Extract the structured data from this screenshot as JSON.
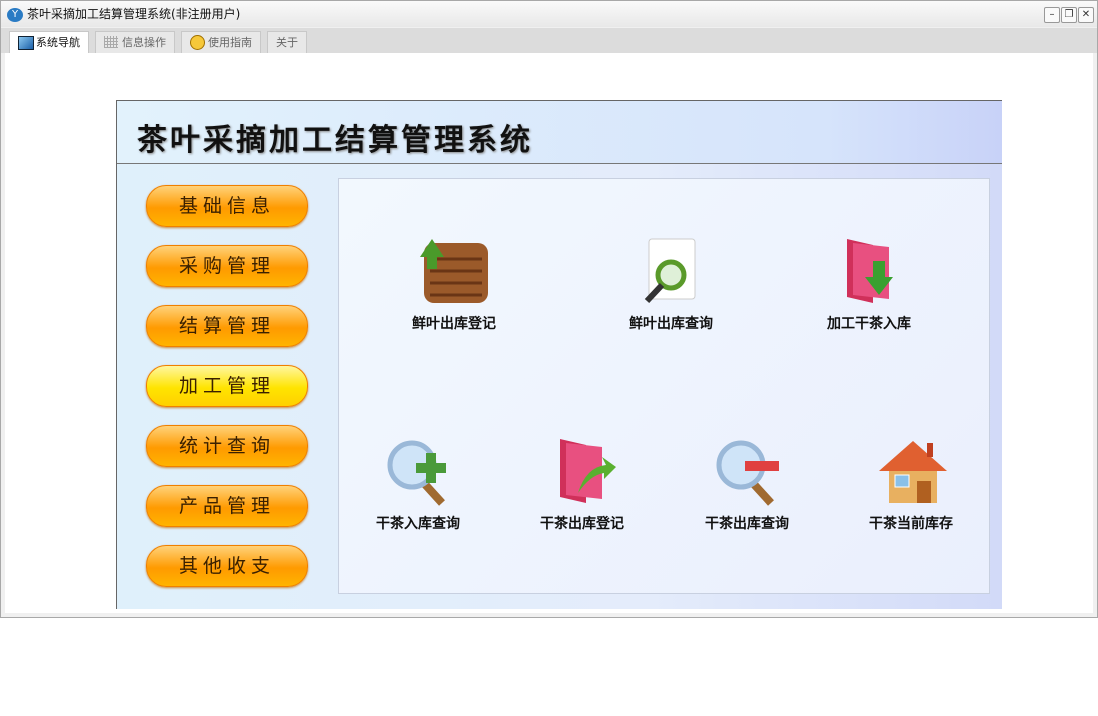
{
  "window": {
    "title": "茶叶采摘加工结算管理系统(非注册用户)",
    "logo": "Y"
  },
  "tabs": [
    {
      "label": "系统导航"
    },
    {
      "label": "信息操作"
    },
    {
      "label": "使用指南"
    },
    {
      "label": "关于"
    }
  ],
  "header": {
    "title": "茶叶采摘加工结算管理系统"
  },
  "menu": [
    {
      "label": "基础信息"
    },
    {
      "label": "采购管理"
    },
    {
      "label": "结算管理"
    },
    {
      "label": "加工管理"
    },
    {
      "label": "统计查询"
    },
    {
      "label": "产品管理"
    },
    {
      "label": "其他收支"
    }
  ],
  "functions": [
    {
      "label": "鲜叶出库登记",
      "icon": "crate-upload-icon"
    },
    {
      "label": "鲜叶出库查询",
      "icon": "document-search-icon"
    },
    {
      "label": "加工干茶入库",
      "icon": "folder-in-icon"
    },
    {
      "label": "干茶入库查询",
      "icon": "search-add-icon"
    },
    {
      "label": "干茶出库登记",
      "icon": "folder-out-icon"
    },
    {
      "label": "干茶出库查询",
      "icon": "search-remove-icon"
    },
    {
      "label": "干茶当前库存",
      "icon": "house-icon"
    }
  ]
}
